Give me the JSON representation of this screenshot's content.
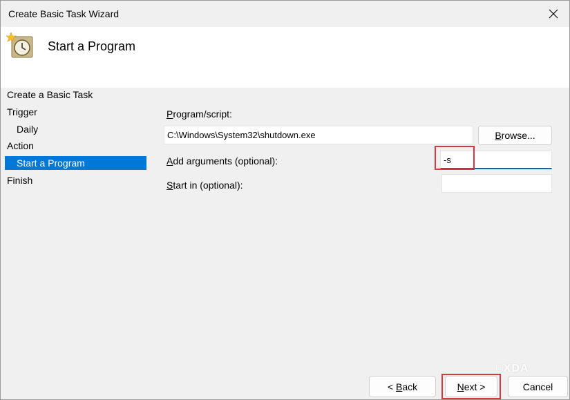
{
  "window": {
    "title": "Create Basic Task Wizard"
  },
  "header": {
    "title": "Start a Program",
    "icon": "task-scheduler-clock-icon"
  },
  "nav": {
    "items": [
      {
        "label": "Create a Basic Task",
        "level": 0,
        "selected": false
      },
      {
        "label": "Trigger",
        "level": 0,
        "selected": false
      },
      {
        "label": "Daily",
        "level": 1,
        "selected": false
      },
      {
        "label": "Action",
        "level": 0,
        "selected": false
      },
      {
        "label": "Start a Program",
        "level": 1,
        "selected": true
      },
      {
        "label": "Finish",
        "level": 0,
        "selected": false
      }
    ]
  },
  "form": {
    "program_label_prefix": "P",
    "program_label_rest": "rogram/script:",
    "program_value": "C:\\Windows\\System32\\shutdown.exe",
    "browse_prefix": "B",
    "browse_rest": "rowse...",
    "args_label_prefix": "A",
    "args_label_rest": "dd arguments (optional):",
    "args_value": "-s",
    "startin_label_prefix": "S",
    "startin_label_rest": "tart in (optional):",
    "startin_value": ""
  },
  "buttons": {
    "back_prefix": "< ",
    "back_mnemonic": "B",
    "back_rest": "ack",
    "next_mnemonic": "N",
    "next_rest": "ext >",
    "cancel": "Cancel"
  },
  "watermark": "XDA",
  "colors": {
    "selection": "#0078d7",
    "highlight": "#d9363e",
    "focus_border": "#0067c0"
  }
}
